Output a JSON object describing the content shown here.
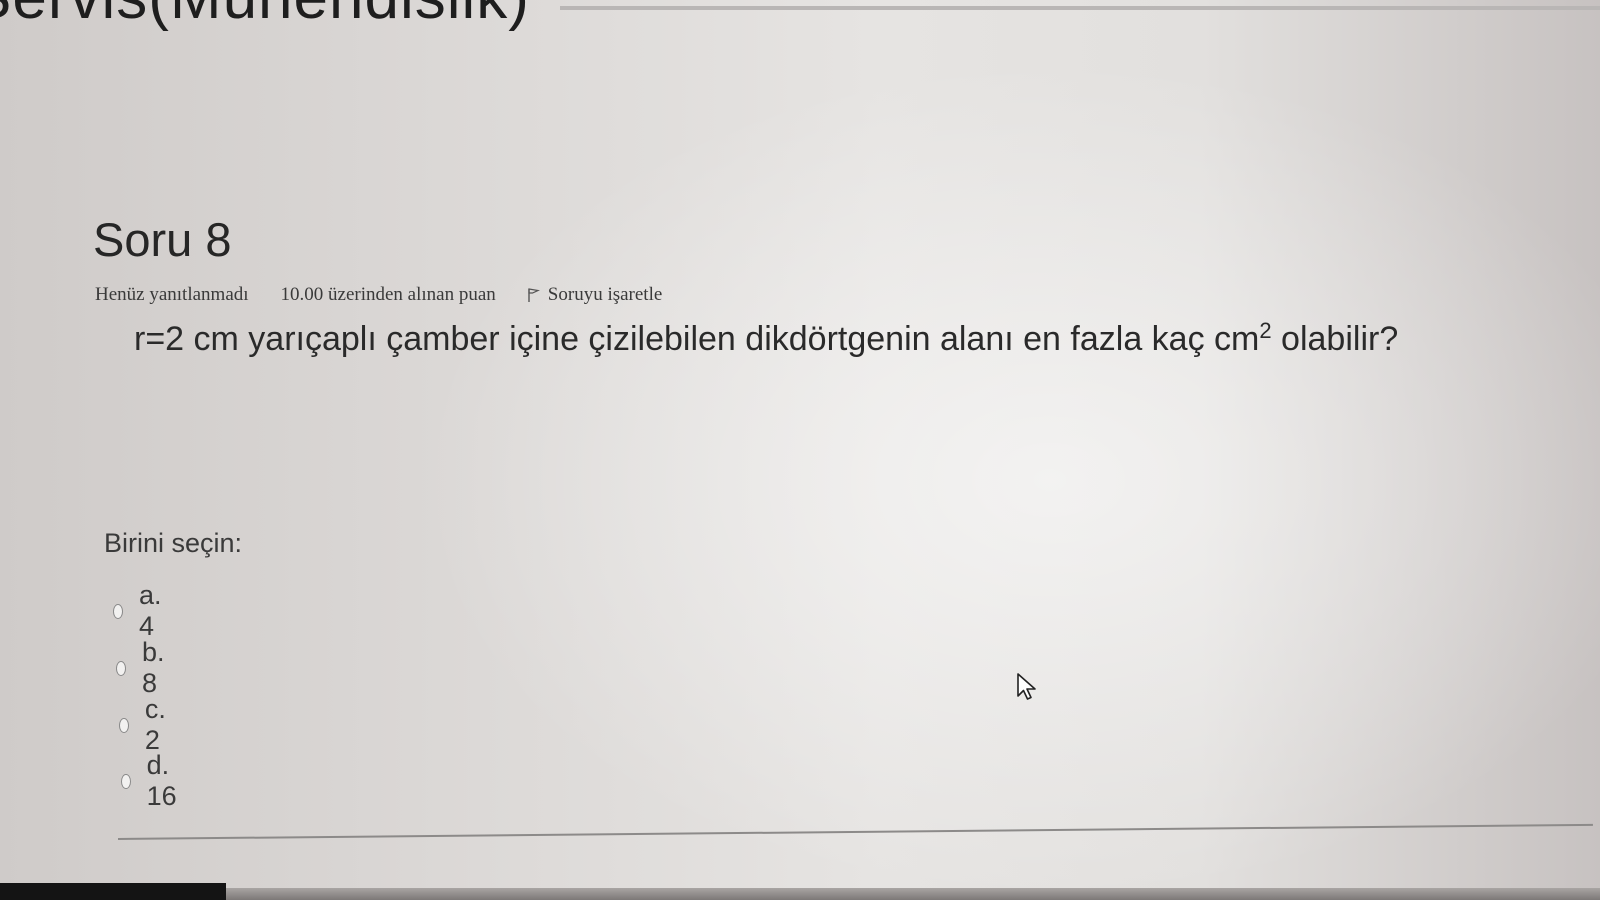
{
  "header": {
    "title": "Servis(Mühendislik)"
  },
  "question": {
    "heading": "Soru 8",
    "status": "Henüz yanıtlanmadı",
    "points": "10.00 üzerinden alınan puan",
    "flag_label": "Soruyu işaretle",
    "text_before": "r=2 cm yarıçaplı çamber içine çizilebilen dikdörtgenin alanı en fazla kaç cm",
    "text_sup": "2",
    "text_after": " olabilir?",
    "prompt": "Birini seçin:",
    "options": [
      {
        "label": "a. 4"
      },
      {
        "label": "b. 8"
      },
      {
        "label": "c. 2"
      },
      {
        "label": "d. 16"
      }
    ]
  },
  "icons": {
    "flag": "flag-icon",
    "radio": "radio-icon",
    "cursor": "mouse-pointer-icon"
  }
}
